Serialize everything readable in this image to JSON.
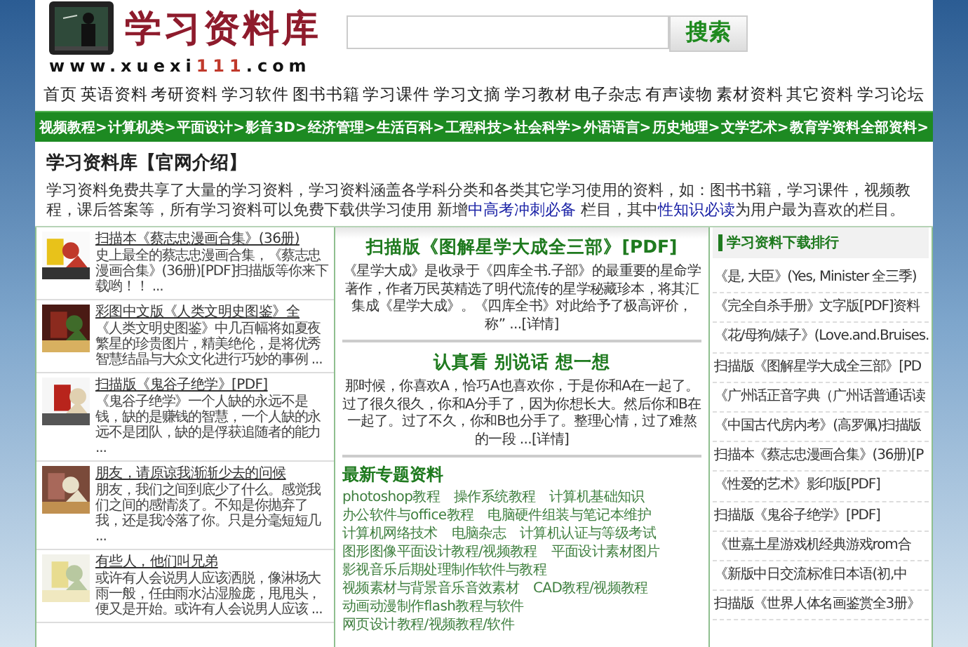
{
  "header": {
    "brand": "学习资料库",
    "url": [
      {
        "text": "www.xuexi",
        "highlight": false
      },
      {
        "text": "111",
        "highlight": true
      },
      {
        "text": ".com",
        "highlight": false
      }
    ],
    "search_button": "搜索"
  },
  "nav": [
    "首页",
    "英语资料",
    "考研资料",
    "学习软件",
    "图书书籍",
    "学习课件",
    "学习文摘",
    "学习教材",
    "电子杂志",
    "有声读物",
    "素材资料",
    "其它资料",
    "学习论坛"
  ],
  "categories": [
    "视频教程>",
    "计算机类>",
    "平面设计>",
    "影音3D>",
    "经济管理>",
    "生活百科>",
    "工程科技>",
    "社会科学>",
    "外语语言>",
    "历史地理>",
    "文学艺术>",
    "教育学资料",
    "全部资料>"
  ],
  "intro": {
    "title": "学习资料库【官网介绍】",
    "parts": [
      {
        "text": "学习资料免费共享了大量的学习资料，学习资料涵盖各学科分类和各类其它学习使用的资料，如：图书书籍，学习课件，视频教程，课后答案等，所有学习资料可以免费下载供学习使用 新增",
        "kind": "text"
      },
      {
        "text": "中高考冲刺必备",
        "kind": "link"
      },
      {
        "text": " 栏目，其中",
        "kind": "text"
      },
      {
        "text": "性知识必读",
        "kind": "link"
      },
      {
        "text": "为用户最为喜欢的栏目。",
        "kind": "text"
      }
    ]
  },
  "left_items": [
    {
      "title": "扫描本《蔡志忠漫画合集》(36册)",
      "desc": "史上最全的蔡志忠漫画合集，《蔡志忠漫画合集》(36册)[PDF]扫描版等你来下载哟！！ ..."
    },
    {
      "title": "彩图中文版《人类文明史图鉴》全",
      "desc": "《人类文明史图鉴》中几百幅将如夏夜繁星的珍贵图片，精美绝伦，是将优秀智慧结晶与大众文化进行巧妙的事例 ..."
    },
    {
      "title": "扫描版《鬼谷子绝学》[PDF]",
      "desc": "《鬼谷子绝学》一个人缺的永远不是钱，缺的是赚钱的智慧，一个人缺的永远不是团队，缺的是俘获追随者的能力 ..."
    },
    {
      "title": "朋友，请原谅我渐渐少去的问候",
      "desc": "朋友，我们之间到底少了什么。感觉我们之间的感情淡了。不知是你抛弃了我，还是我冷落了你。只是分毫短短几 ..."
    },
    {
      "title": "有些人，他们叫兄弟",
      "desc": "或许有人会说男人应该洒脱，像淋场大雨一般，任由雨水沾湿脸庞，甩甩头，便又是开始。或许有人会说男人应该 ..."
    }
  ],
  "articles": [
    {
      "title": "扫描版《图解星学大成全三部》[PDF]",
      "desc": "《星学大成》是收录于《四库全书.子部》的最重要的星命学著作，作者万民英精选了明代流传的星学秘藏珍本，将其汇集成《星学大成》。《四库全书》对此给予了极高评价，称” ...",
      "more": "[详情]"
    },
    {
      "title": "认真看 别说话 想一想",
      "desc": "那时候，你喜欢A，恰巧A也喜欢你，于是你和A在一起了。过了很久很久，你和A分手了，因为你想长大。然后你和B在一起了。过了不久，你和B也分手了。整理心情，过了难熬的一段 ...",
      "more": "[详情]"
    }
  ],
  "topics": {
    "title": "最新专题资料",
    "links": [
      "photoshop教程",
      "操作系统教程",
      "计算机基础知识",
      "办公软件与office教程",
      "电脑硬件组装与笔记本维护",
      "计算机网络技术",
      "电脑杂志",
      "计算机认证与等级考试",
      "图形图像平面设计教程/视频教程",
      "平面设计素材图片",
      "影视音乐后期处理制作软件与教程",
      "视频素材与背景音乐音效素材",
      "CAD教程/视频教程",
      "动画动漫制作flash教程与软件",
      "网页设计教程/视频教程/软件"
    ]
  },
  "ranking": {
    "title": "学习资料下载排行",
    "items": [
      "《是, 大臣》(Yes, Minister 全三季)",
      "《完全自杀手册》文字版[PDF]资料",
      "《花/母狗/婊子》(Love.and.Bruises.",
      "扫描版《图解星学大成全三部》[PD",
      "《广州话正音字典（广州话普通话读",
      "《中国古代房内考》(高罗佩)扫描版",
      "扫描本《蔡志忠漫画合集》(36册)[P",
      "《性爱的艺术》影印版[PDF]",
      "扫描版《鬼谷子绝学》[PDF]",
      "《世嘉土星游戏机经典游戏rom合",
      "《新版中日交流标准日本语(初,中",
      "扫描版《世界人体名画鉴赏全3册》"
    ]
  }
}
